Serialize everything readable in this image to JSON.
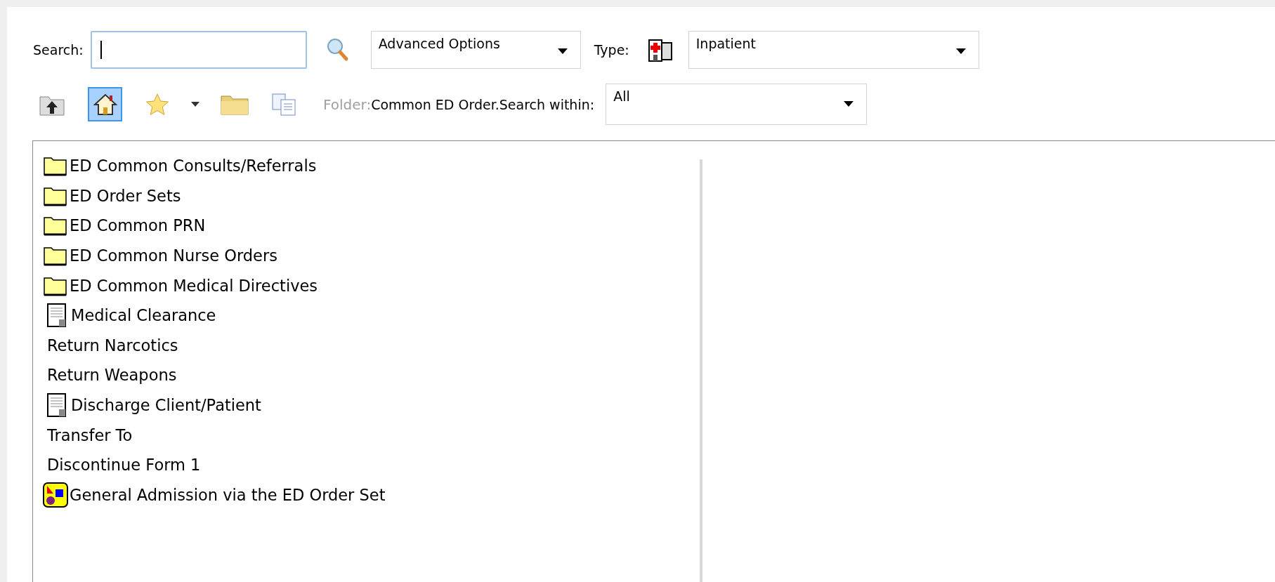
{
  "search": {
    "label": "Search:"
  },
  "advanced_options": {
    "value": "Advanced Options"
  },
  "type": {
    "label": "Type:",
    "value": "Inpatient"
  },
  "toolbar": {
    "buttons": [
      {
        "kind": "up",
        "selected": false
      },
      {
        "kind": "home",
        "selected": true
      },
      {
        "kind": "favorites",
        "selected": false
      },
      {
        "kind": "menu",
        "selected": false
      },
      {
        "kind": "folder",
        "selected": false
      },
      {
        "kind": "copy",
        "selected": false
      }
    ],
    "folder_label": "Folder:",
    "folder_name": "Common ED Order.",
    "search_within_label": "Search within:",
    "search_within": "All"
  },
  "items": [
    {
      "kind": "folder",
      "label": "ED Common Consults/Referrals"
    },
    {
      "kind": "folder",
      "label": "ED Order Sets"
    },
    {
      "kind": "folder",
      "label": "ED Common PRN"
    },
    {
      "kind": "folder",
      "label": "ED Common Nurse Orders"
    },
    {
      "kind": "folder",
      "label": "ED Common Medical Directives"
    },
    {
      "kind": "document",
      "label": "Medical Clearance"
    },
    {
      "kind": "plain",
      "label": "Return Narcotics"
    },
    {
      "kind": "plain",
      "label": "Return Weapons"
    },
    {
      "kind": "document",
      "label": "Discharge Client/Patient"
    },
    {
      "kind": "plain",
      "label": "Transfer To"
    },
    {
      "kind": "plain",
      "label": "Discontinue Form 1"
    },
    {
      "kind": "orderset",
      "label": "General Admission via the ED Order Set"
    }
  ]
}
